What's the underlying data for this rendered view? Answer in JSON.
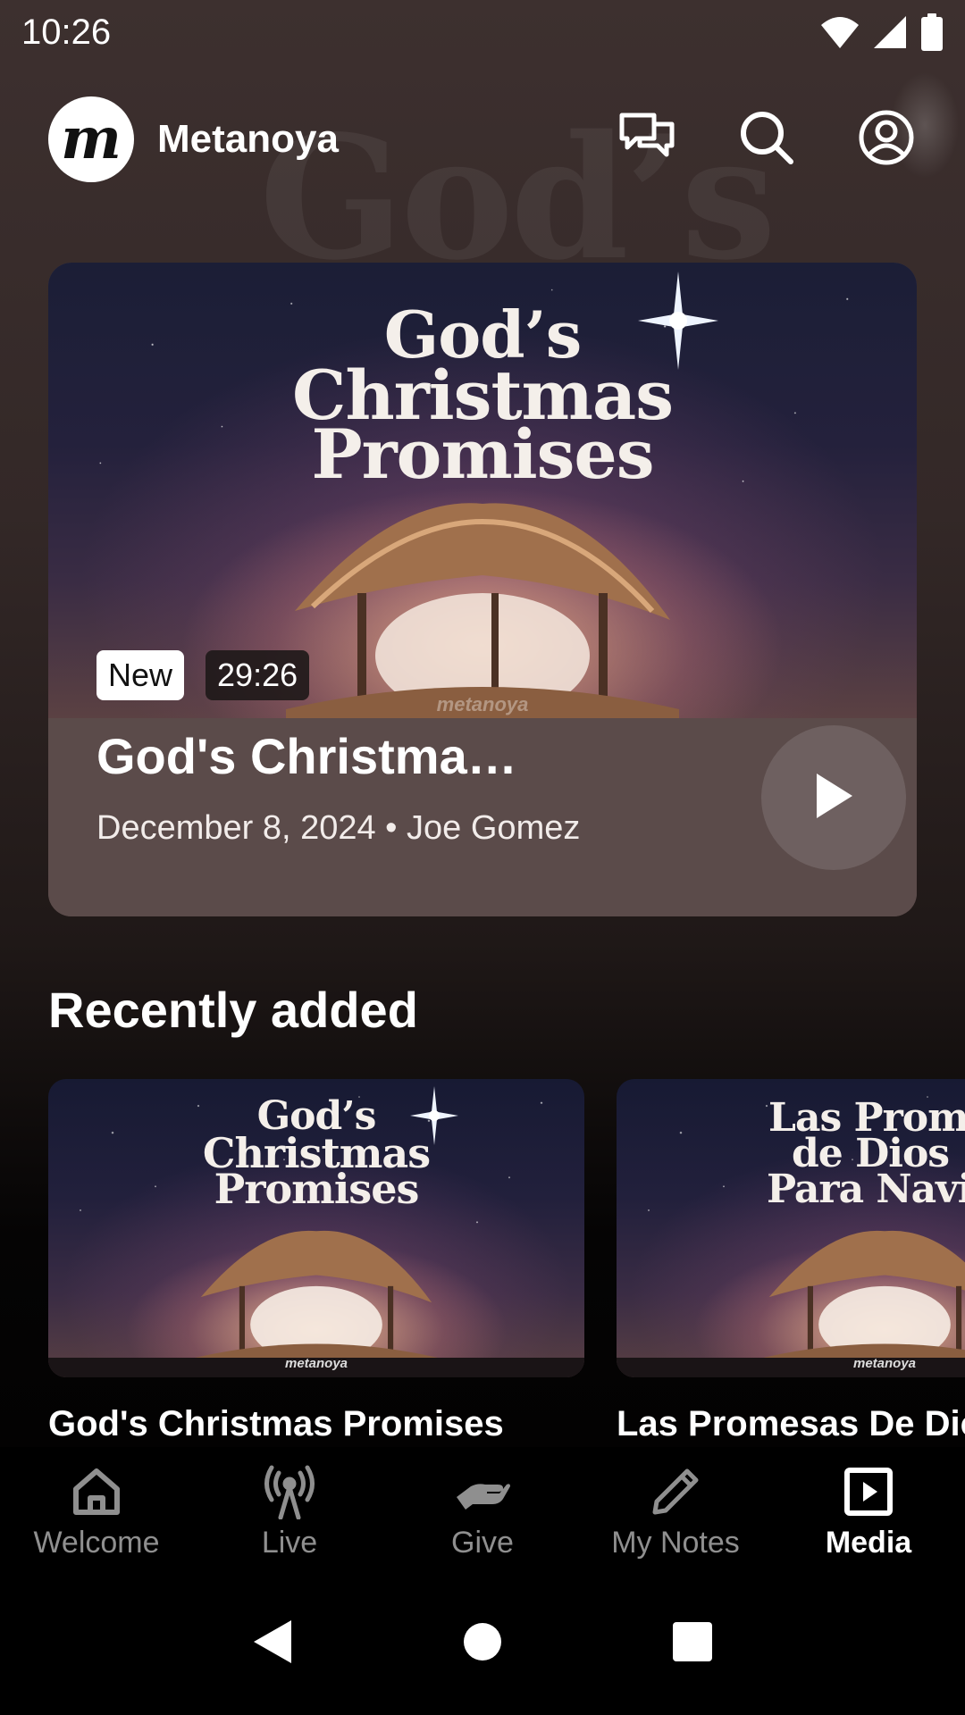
{
  "status_bar": {
    "time": "10:26"
  },
  "header": {
    "app_name": "Metanoya",
    "logo_letter": "m"
  },
  "background": {
    "art_text": "God’s"
  },
  "hero": {
    "art_title_lines": [
      "God’s",
      "Christmas",
      "Promises"
    ],
    "art_watermark": "metanoya",
    "badge_new": "New",
    "duration": "29:26",
    "title": "God's Christma…",
    "meta": "December 8, 2024 • Joe Gomez"
  },
  "recently_added": {
    "heading": "Recently added",
    "items": [
      {
        "art_title_lines": [
          "God’s",
          "Christmas",
          "Promises"
        ],
        "watermark": "metanoya",
        "title": "God's Christmas Promises"
      },
      {
        "art_title_lines": [
          "Las Promes",
          "de Dios",
          "Para Navida"
        ],
        "watermark": "metanoya",
        "title": "Las Promesas De Dio"
      }
    ]
  },
  "bottom_nav": {
    "items": [
      {
        "label": "Welcome",
        "icon": "home-icon",
        "active": false
      },
      {
        "label": "Live",
        "icon": "broadcast-icon",
        "active": false
      },
      {
        "label": "Give",
        "icon": "give-hand-icon",
        "active": false
      },
      {
        "label": "My Notes",
        "icon": "pencil-icon",
        "active": false
      },
      {
        "label": "Media",
        "icon": "media-play-icon",
        "active": true
      }
    ]
  },
  "colors": {
    "background_top": "#3d302f",
    "card_overlay": "#5b4b4a",
    "nav_inactive": "#8f8f8f",
    "nav_active": "#ffffff"
  }
}
